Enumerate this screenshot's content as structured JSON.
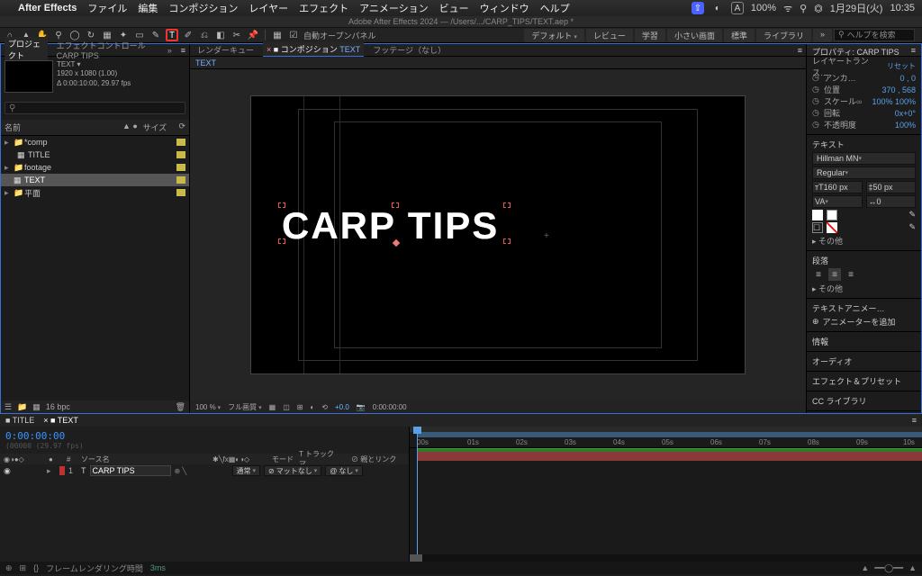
{
  "menubar": {
    "app": "After Effects",
    "items": [
      "ファイル",
      "編集",
      "コンポジション",
      "レイヤー",
      "エフェクト",
      "アニメーション",
      "ビュー",
      "ウィンドウ",
      "ヘルプ"
    ],
    "doc_title": "Adobe After Effects 2024 — /Users/.../CARP_TIPS/TEXT.aep *",
    "right": {
      "battery": "100%",
      "date": "1月29日(火)",
      "time": "10:35"
    }
  },
  "toolbar": {
    "type_label": "T",
    "auto_open": "自動オープンパネル",
    "workspaces": [
      "デフォルト",
      "レビュー",
      "学習",
      "小さい画面",
      "標準",
      "ライブラリ"
    ],
    "search_ph": "ヘルプを検索"
  },
  "project": {
    "tabs": {
      "project": "プロジェクト",
      "effects": "エフェクトコントロール CARP TIPS"
    },
    "item_name": "TEXT ▾",
    "meta1": "1920 x 1080 (1.00)",
    "meta2": "Δ 0:00:10:00, 29.97 fps",
    "search_ph": "",
    "cols": {
      "name": "名前",
      "tag": "●",
      "type": "サイズ"
    },
    "rows": [
      {
        "tw": "▸",
        "ic": "📁",
        "name": "*comp",
        "sel": false
      },
      {
        "tw": "",
        "ic": "▦",
        "name": "TITLE",
        "sel": false,
        "indent": 1
      },
      {
        "tw": "▸",
        "ic": "📁",
        "name": "footage",
        "sel": false
      },
      {
        "tw": "",
        "ic": "▦",
        "name": "TEXT",
        "sel": true
      },
      {
        "tw": "▸",
        "ic": "📁",
        "name": "平面",
        "sel": false
      }
    ],
    "footer": {
      "bpc": "16 bpc"
    }
  },
  "viewer": {
    "tabs": {
      "render": "レンダーキュー",
      "comp_prefix": "■ コンポジション",
      "comp": "TEXT",
      "footage": "フッテージ（なし）"
    },
    "mini_tab": "TEXT",
    "text": "CARP TIPS",
    "footer": {
      "zoom": "100 %",
      "quality": "フル画質",
      "time": "0:00:00:00",
      "exposure": "+0.0"
    }
  },
  "props": {
    "title": "プロパティ: CARP TIPS",
    "transform_title": "レイヤートランス…",
    "reset": "リセット",
    "rows": {
      "anchor": {
        "lab": "アンカ…",
        "v": "0  ,  0"
      },
      "pos": {
        "lab": "位置",
        "v": "370  ,  568"
      },
      "scale": {
        "lab": "スケール",
        "v": "100%  100%",
        "link": "∞"
      },
      "rot": {
        "lab": "回転",
        "v": "0x+0°"
      },
      "opac": {
        "lab": "不透明度",
        "v": "100%"
      }
    },
    "text_section": "テキスト",
    "font": "Hillman MN",
    "weight": "Regular",
    "size": "160 px",
    "leading": "50 px",
    "va": "VA",
    "tracking": "0",
    "more": "▸ その他",
    "para": "段落",
    "anim": "テキストアニメー…",
    "anim_add": "アニメーターを追加",
    "sections": [
      "情報",
      "オーディオ",
      "エフェクト＆プリセット",
      "CC ライブラリ"
    ]
  },
  "timeline": {
    "tabs": [
      "TITLE",
      "TEXT"
    ],
    "timecode": "0:00:00:00",
    "frames": "(00000 (29.97 fps)",
    "cols": {
      "src": "ソース名",
      "mode": "モード",
      "trk": "T トラックマ…",
      "parent": "親とリンク"
    },
    "layer": {
      "idx": "1",
      "type": "T",
      "name": "CARP TIPS",
      "mode": "通常",
      "trk": "マットなし",
      "parent": "なし"
    },
    "ruler": [
      "00s",
      "01s",
      "02s",
      "03s",
      "04s",
      "05s",
      "06s",
      "07s",
      "08s",
      "09s",
      "10s"
    ],
    "footer": "フレームレンダリング時間",
    "footer_val": "3ms"
  }
}
